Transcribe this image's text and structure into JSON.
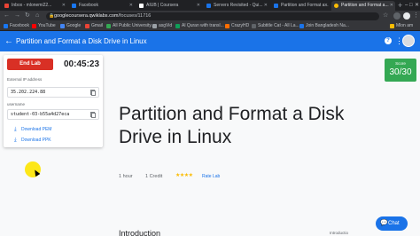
{
  "browser": {
    "tabs": [
      {
        "label": "Inbox - mlonemi22...",
        "color": "#ea4335"
      },
      {
        "label": "Facebook",
        "color": "#1877f2"
      },
      {
        "label": "AIUB | Coursera",
        "color": "#ffffff"
      },
      {
        "label": "Servers Revisited - Qui...",
        "color": "#1a73e8"
      },
      {
        "label": "Partition and Format a...",
        "color": "#1a73e8"
      },
      {
        "label": "Partition and Format a...",
        "color": "#fbbc04"
      }
    ],
    "new_tab_label": "+",
    "minimize": "–",
    "maximize": "□",
    "close": "✕",
    "url_host": "googlecoursera.qwiklabs.com",
    "url_path": "/focuses/11716",
    "bookmarks": [
      {
        "label": "Facebook",
        "color": "#1877f2"
      },
      {
        "label": "YouTube",
        "color": "#ff0000"
      },
      {
        "label": "Google",
        "color": "#4285f4"
      },
      {
        "label": "Gmail",
        "color": "#ea4335"
      },
      {
        "label": "All Public University...",
        "color": "#34a853"
      },
      {
        "label": "asgVid",
        "color": "#9aa0a6"
      },
      {
        "label": "Al Quran with transl...",
        "color": "#0f9d58"
      },
      {
        "label": "CrazyHD",
        "color": "#ff6d00"
      },
      {
        "label": "Subtitle Cat - All La...",
        "color": "#5f6368"
      },
      {
        "label": "Join Bangladesh Na...",
        "color": "#1a73e8"
      },
      {
        "label": "Mlon am",
        "color": "#fbbc04"
      }
    ]
  },
  "header": {
    "back_icon": "←",
    "title": "Partition and Format a Disk Drive in Linux",
    "help_icon": "?",
    "more_icon": "⋮"
  },
  "lab": {
    "end_label": "End Lab",
    "timer": "00:45:23",
    "ip_label": "External IP address",
    "ip_value": "35.202.224.88",
    "user_label": "username",
    "user_value": "student-03-b55a4d27eca",
    "download_pem": "Download PEM",
    "download_ppk": "Download PPK"
  },
  "score": {
    "label": "Score",
    "value": "30/30"
  },
  "main": {
    "title": "Partition and Format a Disk Drive in Linux",
    "duration": "1 hour",
    "credit": "1 Credit",
    "stars": "★★★★",
    "rate_label": "Rate Lab",
    "intro_heading": "Introduction",
    "intro_tab": "Introductio"
  },
  "chat": {
    "label": "Chat"
  }
}
